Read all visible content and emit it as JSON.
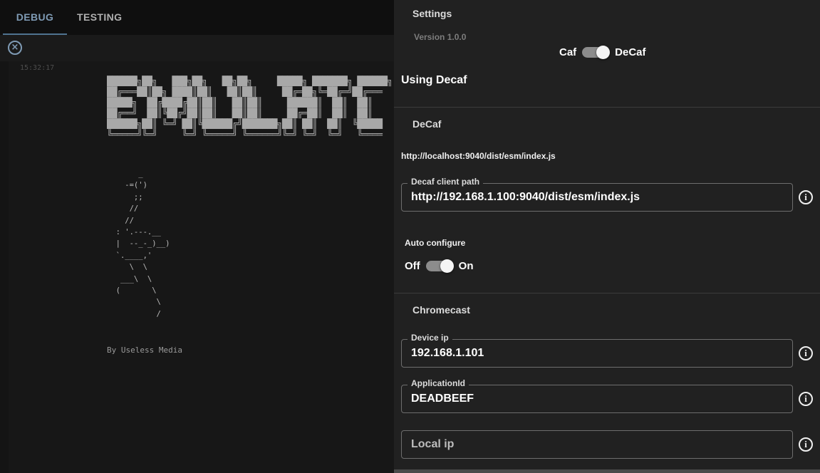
{
  "tabs": [
    {
      "label": "DEBUG",
      "active": true
    },
    {
      "label": "TESTING",
      "active": false
    }
  ],
  "console": {
    "timestamp": "15:32:17",
    "ascii_logo": "██████╗██╗   ███╗██╗   ██╗██╗     █████╗ ███████╗ ██████╗\n██╔═══██║██╗ ████║██║   ██║██║     ██╔═██╗╚═██╔═╝██╔═══\n█████╗  ██╔████╔██║██║   ██║██║     ██████║  ██║  ██║   \n██╔══╝  ██║╚██╔╝██║██║   ██║██║     ██╔═██║  ██║  ██║   \n██████╗██║ ╚═╝ ██║╚██████╔╝███████╗██║ ██║  ██║  ╚█████\n╚═════╝╚═╝     ╚═╝ ╚═════╝ ╚══════╝╚═╝ ╚═╝  ╚═╝   ╚════",
    "ascii_dancer": "       _\n    -=(')\n      ;;\n     //\n    //\n  : '.---.__\n  |  --_-_)__)\n  `.____,'\n     \\  \\\n   ___\\  \\\n  (       \\\n           \\\n           /",
    "byline": "By Useless Media"
  },
  "settings": {
    "title": "Settings",
    "version": "Version 1.0.0",
    "mode_switch": {
      "left_label": "Caf",
      "right_label": "DeCaf",
      "on": true
    },
    "using_label": "Using Decaf",
    "decaf": {
      "section_title": "DeCaf",
      "current_url": "http://localhost:9040/dist/esm/index.js",
      "client_path_label": "Decaf client path",
      "client_path_value": "http://192.168.1.100:9040/dist/esm/index.js",
      "auto_configure_label": "Auto configure",
      "auto_switch": {
        "left_label": "Off",
        "right_label": "On",
        "on": true
      }
    },
    "chromecast": {
      "section_title": "Chromecast",
      "device_ip_label": "Device ip",
      "device_ip_value": "192.168.1.101",
      "application_id_label": "ApplicationId",
      "application_id_value": "DEADBEEF",
      "local_ip_placeholder": "Local ip"
    }
  },
  "icons": {
    "close": "close-circle-icon",
    "info": "info-icon"
  },
  "colors": {
    "accent": "#7f9bb5",
    "panel_bg": "#212121",
    "page_bg": "#141414"
  }
}
